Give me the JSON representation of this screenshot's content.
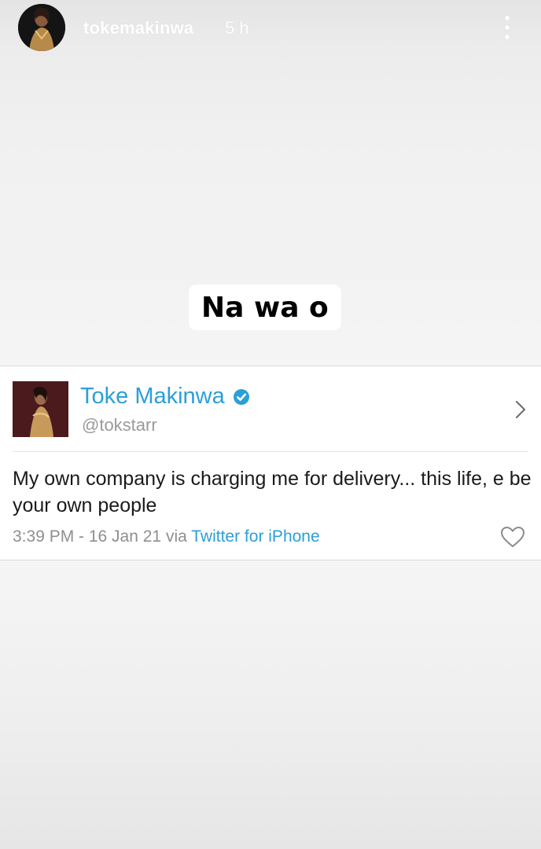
{
  "story": {
    "username": "tokemakinwa",
    "time_ago": "5 h",
    "menu_icon": "more-vertical-icon",
    "caption": "Na wa o"
  },
  "tweet": {
    "display_name": "Toke Makinwa",
    "verified_icon": "verified-badge-icon",
    "handle": "@tokstarr",
    "text": "My own company is charging me for delivery... this life, e be your own people",
    "timestamp": "3:39 PM - 16 Jan 21 via ",
    "source": "Twitter for iPhone",
    "like_icon": "heart-outline-icon",
    "chevron_icon": "chevron-right-icon"
  },
  "colors": {
    "link_blue": "#2b9fd8",
    "meta_gray": "#8f8f8f",
    "card_bg": "#ffffff",
    "story_bg": "#f3f3f3"
  }
}
